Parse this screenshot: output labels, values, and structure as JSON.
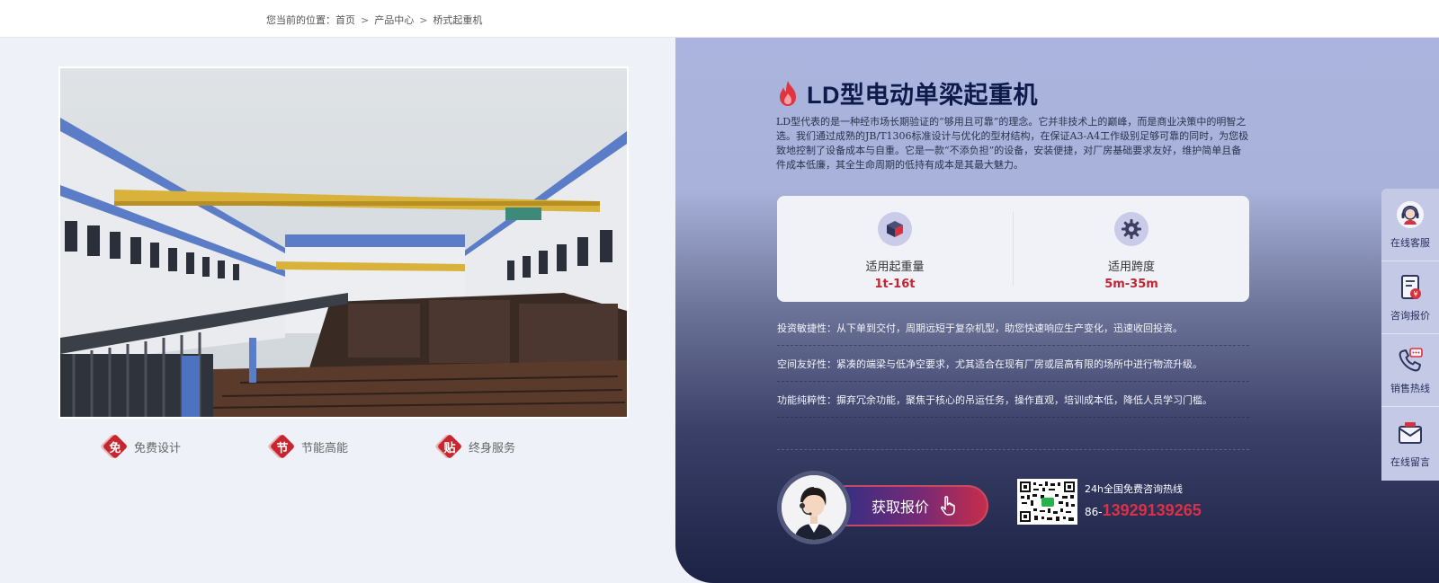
{
  "breadcrumb": {
    "prefix": "您当前的位置：",
    "items": [
      "首页",
      "产品中心",
      "桥式起重机"
    ],
    "separator": ">"
  },
  "product_image": {
    "icon": "crane-photo"
  },
  "features": [
    {
      "badge": "免",
      "label": "免费设计"
    },
    {
      "badge": "节",
      "label": "节能高能"
    },
    {
      "badge": "贴",
      "label": "终身服务"
    }
  ],
  "product": {
    "title": "LD型电动单梁起重机",
    "description": "LD型代表的是一种经市场长期验证的“够用且可靠”的理念。它并非技术上的巅峰，而是商业决策中的明智之选。我们通过成熟的JB/T1306标准设计与优化的型材结构，在保证A3-A4工作级别足够可靠的同时，为您极致地控制了设备成本与自重。它是一款“不添负担”的设备，安装便捷，对厂房基础要求友好，维护简单且备件成本低廉，其全生命周期的低持有成本是其最大魅力。"
  },
  "specs": [
    {
      "icon": "cube-icon",
      "label": "适用起重量",
      "value": "1t-16t"
    },
    {
      "icon": "gear-icon",
      "label": "适用跨度",
      "value": "5m-35m"
    }
  ],
  "points": [
    "投资敏捷性：从下单到交付，周期远短于复杂机型，助您快速响应生产变化，迅速收回投资。",
    "空间友好性：紧凑的端梁与低净空要求，尤其适合在现有厂房或层高有限的场所中进行物流升级。",
    "功能纯粹性：摒弃冗余功能，聚焦于核心的吊运任务，操作直观，培训成本低，降低人员学习门槛。"
  ],
  "cta": {
    "quote_label": "获取报价",
    "hotline_label": "24h全国免费咨询热线",
    "phone_prefix": "86-",
    "phone_number": "13929139265"
  },
  "sidebar": [
    {
      "icon": "customer-service-icon",
      "label": "在线客服"
    },
    {
      "icon": "quote-document-icon",
      "label": "咨询报价"
    },
    {
      "icon": "phone-icon",
      "label": "销售热线"
    },
    {
      "icon": "mail-icon",
      "label": "在线留言"
    }
  ],
  "colors": {
    "accent_red": "#c02635",
    "title_navy": "#0e1a4a",
    "panel_top": "#aab4de",
    "panel_bottom": "#1c2245"
  }
}
